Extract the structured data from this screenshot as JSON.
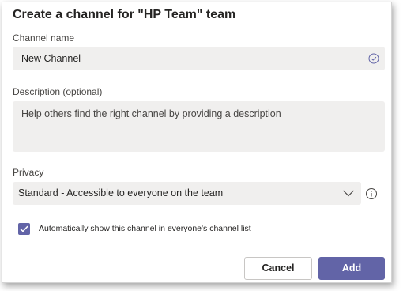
{
  "dialog": {
    "title": "Create a channel for \"HP Team\" team"
  },
  "channel_name": {
    "label": "Channel name",
    "value": "New Channel",
    "valid_icon": "check-circle-icon"
  },
  "description": {
    "label": "Description (optional)",
    "placeholder": "Help others find the right channel by providing a description"
  },
  "privacy": {
    "label": "Privacy",
    "selected": "Standard - Accessible to everyone on the team",
    "dropdown_icon": "chevron-down-icon",
    "info_icon": "info-icon"
  },
  "auto_show": {
    "checked": true,
    "label": "Automatically show this channel in everyone's channel list"
  },
  "buttons": {
    "cancel_label": "Cancel",
    "add_label": "Add"
  },
  "colors": {
    "accent": "#6264a7",
    "field_background": "#f0efee"
  }
}
